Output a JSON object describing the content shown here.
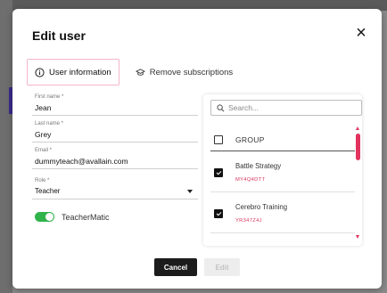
{
  "modal": {
    "title": "Edit user",
    "close_icon": "close-icon"
  },
  "tabs": [
    {
      "label": "User information",
      "icon": "info-icon",
      "active": true
    },
    {
      "label": "Remove subscriptions",
      "icon": "graduation-cap-icon",
      "active": false
    }
  ],
  "form": {
    "first_name": {
      "label": "First name *",
      "value": "Jean"
    },
    "last_name": {
      "label": "Last name *",
      "value": "Grey"
    },
    "email": {
      "label": "Email *",
      "value": "dummyteach@avallain.com"
    },
    "role": {
      "label": "Role *",
      "value": "Teacher"
    },
    "teachermatic": {
      "label": "TeacherMatic",
      "enabled": true
    }
  },
  "groups": {
    "search_placeholder": "Search...",
    "header": "GROUP",
    "items": [
      {
        "name": "Battle Strategy",
        "code": "MY4Q4DTT",
        "checked": true
      },
      {
        "name": "Cerebro Training",
        "code": "YR347Z4J",
        "checked": true
      }
    ]
  },
  "footer": {
    "cancel_label": "Cancel",
    "edit_label": "Edit"
  },
  "colors": {
    "accent": "#e2335f",
    "toggle_on": "#2fb34a",
    "primary_button": "#1c1c1c"
  }
}
